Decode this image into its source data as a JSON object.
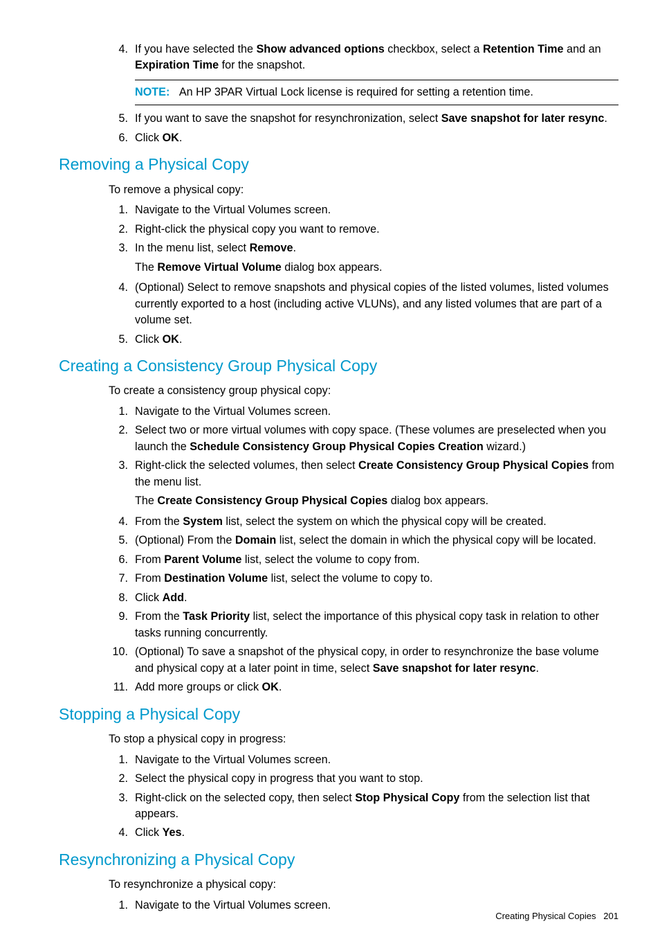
{
  "section0": {
    "item4_a": "If you have selected the ",
    "item4_b": "Show advanced options",
    "item4_c": " checkbox, select a ",
    "item4_d": "Retention Time",
    "item4_e": " and an ",
    "item4_f": "Expiration Time",
    "item4_g": " for the snapshot.",
    "note_label": "NOTE:",
    "note_text": "An HP 3PAR Virtual Lock license is required for setting a retention time.",
    "item5_a": "If you want to save the snapshot for resynchronization, select ",
    "item5_b": "Save snapshot for later resync",
    "item5_c": ".",
    "item6_a": "Click ",
    "item6_b": "OK",
    "item6_c": "."
  },
  "removing": {
    "title": "Removing a Physical Copy",
    "intro": "To remove a physical copy:",
    "i1": "Navigate to the Virtual Volumes screen.",
    "i2": "Right-click the physical copy you want to remove.",
    "i3a": "In the menu list, select ",
    "i3b": "Remove",
    "i3c": ".",
    "i3suba": "The ",
    "i3subb": "Remove Virtual Volume",
    "i3subc": " dialog box appears.",
    "i4": "(Optional) Select to remove snapshots and physical copies of the listed volumes, listed volumes currently exported to a host (including active VLUNs), and any listed volumes that are part of a volume set.",
    "i5a": "Click ",
    "i5b": "OK",
    "i5c": "."
  },
  "creating": {
    "title": "Creating a Consistency Group Physical Copy",
    "intro": "To create a consistency group physical copy:",
    "i1": "Navigate to the Virtual Volumes screen.",
    "i2a": "Select two or more virtual volumes with copy space. (These volumes are preselected when you launch the ",
    "i2b": "Schedule Consistency Group Physical Copies Creation",
    "i2c": " wizard.)",
    "i3a": "Right-click the selected volumes, then select ",
    "i3b": "Create Consistency Group Physical Copies",
    "i3c": " from the menu list.",
    "i3suba": "The ",
    "i3subb": "Create Consistency Group Physical Copies",
    "i3subc": " dialog box appears.",
    "i4a": "From the ",
    "i4b": "System",
    "i4c": " list, select the system on which the physical copy will be created.",
    "i5a": "(Optional) From the ",
    "i5b": "Domain",
    "i5c": " list, select the domain in which the physical copy will be located.",
    "i6a": "From ",
    "i6b": "Parent Volume",
    "i6c": " list, select the volume to copy from.",
    "i7a": "From ",
    "i7b": "Destination Volume",
    "i7c": " list, select the volume to copy to.",
    "i8a": "Click ",
    "i8b": "Add",
    "i8c": ".",
    "i9a": "From the ",
    "i9b": "Task Priority",
    "i9c": " list, select the importance of this physical copy task in relation to other tasks running concurrently.",
    "i10a": "(Optional) To save a snapshot of the physical copy, in order to resynchronize the base volume and physical copy at a later point in time, select ",
    "i10b": "Save snapshot for later resync",
    "i10c": ".",
    "i11a": "Add more groups or click ",
    "i11b": "OK",
    "i11c": "."
  },
  "stopping": {
    "title": "Stopping a Physical Copy",
    "intro": "To stop a physical copy in progress:",
    "i1": "Navigate to the Virtual Volumes screen.",
    "i2": "Select the physical copy in progress that you want to stop.",
    "i3a": "Right-click on the selected copy, then select ",
    "i3b": "Stop Physical Copy",
    "i3c": " from the selection list that appears.",
    "i4a": "Click ",
    "i4b": "Yes",
    "i4c": "."
  },
  "resync": {
    "title": "Resynchronizing a Physical Copy",
    "intro": "To resynchronize a physical copy:",
    "i1": "Navigate to the Virtual Volumes screen."
  },
  "footer": {
    "text": "Creating Physical Copies",
    "page": "201"
  },
  "nums": {
    "n1": "1.",
    "n2": "2.",
    "n3": "3.",
    "n4": "4.",
    "n5": "5.",
    "n6": "6.",
    "n7": "7.",
    "n8": "8.",
    "n9": "9.",
    "n10": "10.",
    "n11": "11."
  }
}
